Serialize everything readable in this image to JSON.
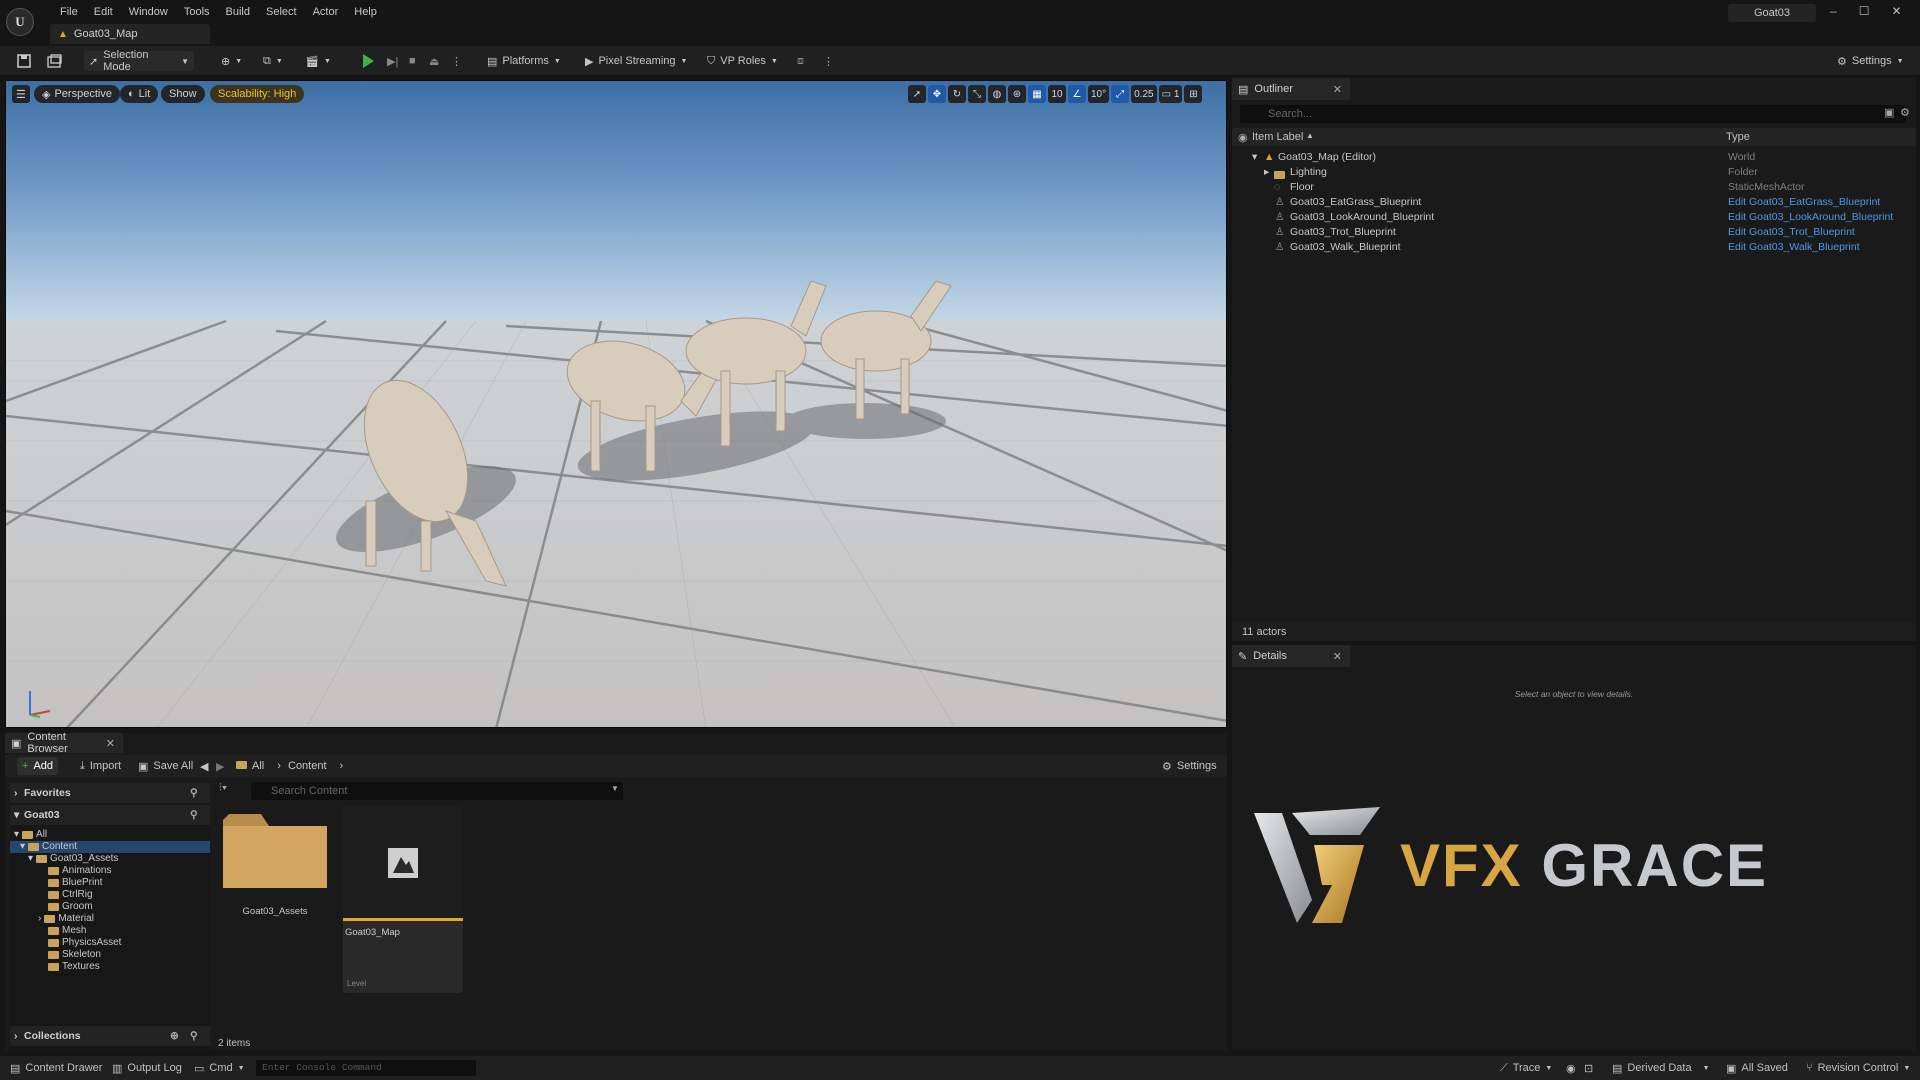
{
  "app": {
    "project_name": "Goat03",
    "map_tab": "Goat03_Map",
    "logo_letter": "U"
  },
  "menu": [
    "File",
    "Edit",
    "Window",
    "Tools",
    "Build",
    "Select",
    "Actor",
    "Help"
  ],
  "toolbar": {
    "selection_mode": "Selection Mode",
    "platforms": "Platforms",
    "pixel_streaming": "Pixel Streaming",
    "vp_roles": "VP Roles",
    "settings": "Settings"
  },
  "viewport": {
    "perspective": "Perspective",
    "lit": "Lit",
    "show": "Show",
    "scalability": "Scalability: High",
    "grid_snap": "10",
    "rotation_snap": "10°",
    "scale_snap": "0.25",
    "camera_speed": "1"
  },
  "outliner": {
    "tab_label": "Outliner",
    "search_placeholder": "Search...",
    "col_label": "Item Label",
    "col_type": "Type",
    "rows": [
      {
        "label": "Goat03_Map (Editor)",
        "type": "World"
      },
      {
        "label": "Lighting",
        "type": "Folder"
      },
      {
        "label": "Floor",
        "type": "StaticMeshActor"
      },
      {
        "label": "Goat03_EatGrass_Blueprint",
        "type": "Edit Goat03_EatGrass_Blueprint"
      },
      {
        "label": "Goat03_LookAround_Blueprint",
        "type": "Edit Goat03_LookAround_Blueprint"
      },
      {
        "label": "Goat03_Trot_Blueprint",
        "type": "Edit Goat03_Trot_Blueprint"
      },
      {
        "label": "Goat03_Walk_Blueprint",
        "type": "Edit Goat03_Walk_Blueprint"
      }
    ],
    "actor_count": "11 actors"
  },
  "details": {
    "tab_label": "Details",
    "empty_message": "Select an object to view details."
  },
  "watermark": {
    "text": "VFX GRACE",
    "colors": {
      "gold": "#d8a543",
      "silver": "#c5c8cc"
    }
  },
  "content_browser": {
    "tab_label": "Content Browser",
    "add": "Add",
    "import": "Import",
    "save_all": "Save All",
    "path": [
      "All",
      "Content"
    ],
    "settings": "Settings",
    "favorites": "Favorites",
    "project": "Goat03",
    "tree": {
      "all": "All",
      "content": "Content",
      "assets": "Goat03_Assets",
      "subfolders": [
        "Animations",
        "BluePrint",
        "CtrlRig",
        "Groom",
        "Material",
        "Mesh",
        "PhysicsAsset",
        "Skeleton",
        "Textures"
      ]
    },
    "collections": "Collections",
    "search_placeholder": "Search Content",
    "items": [
      {
        "name": "Goat03_Assets"
      },
      {
        "name": "Goat03_Map",
        "type": "Level"
      }
    ],
    "item_count": "2 items"
  },
  "statusbar": {
    "content_drawer": "Content Drawer",
    "output_log": "Output Log",
    "cmd": "Cmd",
    "console_placeholder": "Enter Console Command",
    "trace": "Trace",
    "derived_data": "Derived Data",
    "all_saved": "All Saved",
    "revision_control": "Revision Control"
  },
  "colors": {
    "accent_blue": "#1f5aa8",
    "play_green": "#3fb43f",
    "scalability": "#f0c030",
    "link": "#4f97e8",
    "folder": "#c9a25c",
    "level_underline": "#e8a326"
  }
}
